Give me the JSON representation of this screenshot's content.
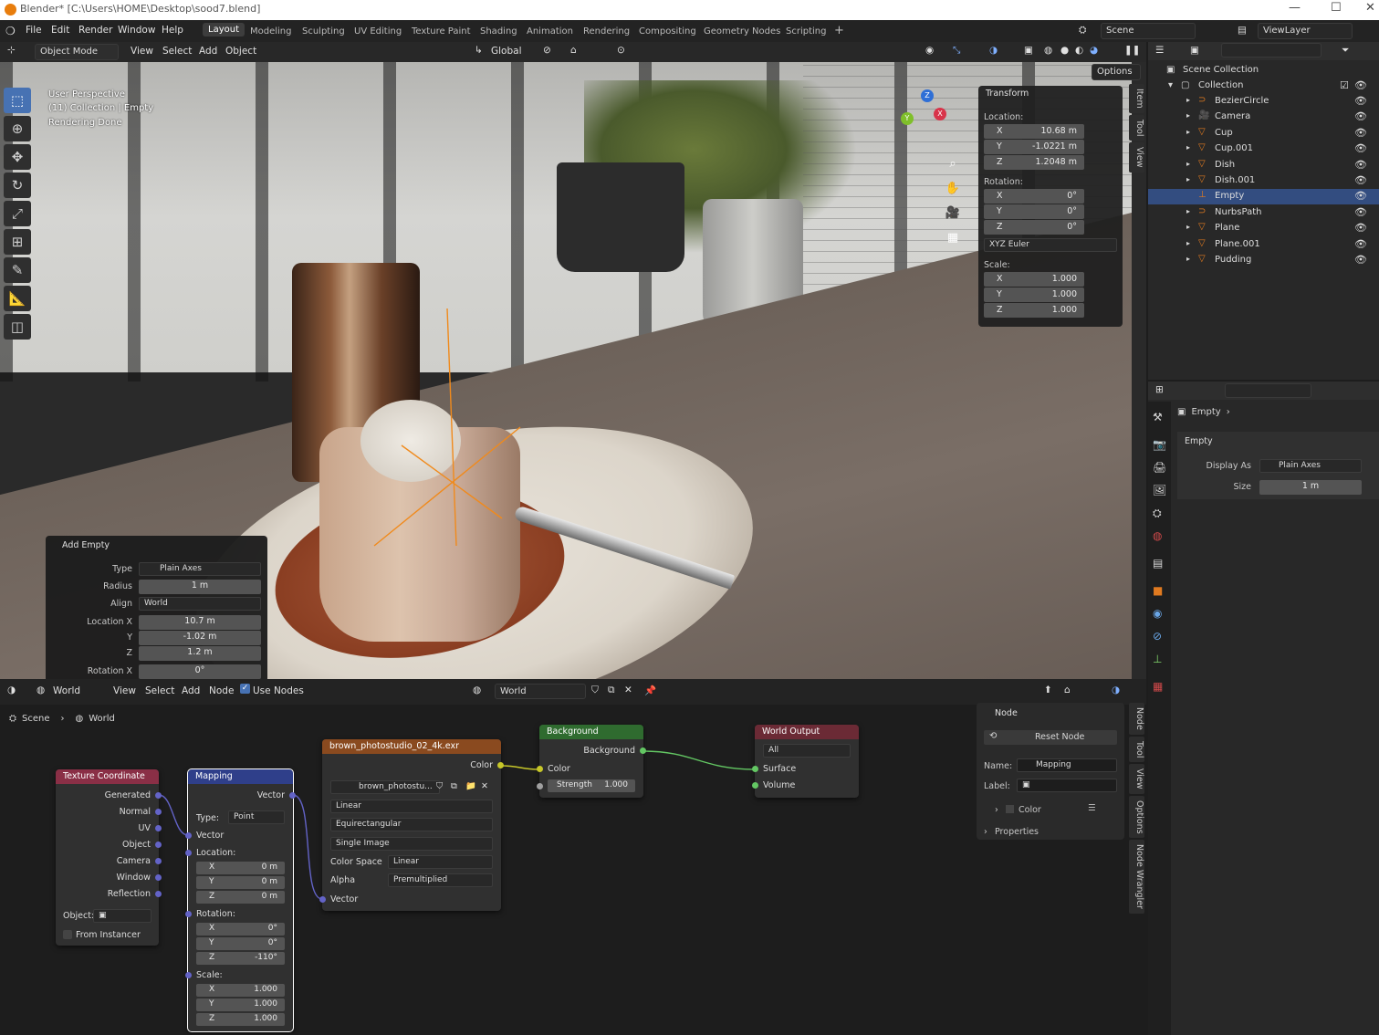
{
  "titlebar": {
    "title": "Blender* [C:\\Users\\HOME\\Desktop\\sood7.blend]"
  },
  "menu": [
    "File",
    "Edit",
    "Render",
    "Window",
    "Help"
  ],
  "workspaces": [
    "Layout",
    "Modeling",
    "Sculpting",
    "UV Editing",
    "Texture Paint",
    "Shading",
    "Animation",
    "Rendering",
    "Compositing",
    "Geometry Nodes",
    "Scripting"
  ],
  "active_workspace": "Layout",
  "scene": {
    "name": "Scene",
    "viewlayer": "ViewLayer"
  },
  "viewport": {
    "mode": "Object Mode",
    "menus": [
      "View",
      "Select",
      "Add",
      "Object"
    ],
    "orientation": "Global",
    "options": "Options",
    "overlay": [
      "User Perspective",
      "(11) Collection | Empty",
      "Rendering Done"
    ],
    "tabs": [
      "Item",
      "Tool",
      "View"
    ]
  },
  "transform": {
    "title": "Transform",
    "location_label": "Location:",
    "rotation_label": "Rotation:",
    "scale_label": "Scale:",
    "location": [
      {
        "k": "X",
        "v": "10.68 m"
      },
      {
        "k": "Y",
        "v": "-1.0221 m"
      },
      {
        "k": "Z",
        "v": "1.2048 m"
      }
    ],
    "rotation": [
      {
        "k": "X",
        "v": "0°"
      },
      {
        "k": "Y",
        "v": "0°"
      },
      {
        "k": "Z",
        "v": "0°"
      }
    ],
    "rotation_mode": "XYZ Euler",
    "scale": [
      {
        "k": "X",
        "v": "1.000"
      },
      {
        "k": "Y",
        "v": "1.000"
      },
      {
        "k": "Z",
        "v": "1.000"
      }
    ]
  },
  "add_empty": {
    "title": "Add Empty",
    "rows": [
      {
        "label": "Type",
        "value": "Plain Axes"
      },
      {
        "label": "Radius",
        "value": "1 m"
      },
      {
        "label": "Align",
        "value": "World"
      },
      {
        "label": "Location X",
        "value": "10.7 m"
      },
      {
        "label": "Y",
        "value": "-1.02 m"
      },
      {
        "label": "Z",
        "value": "1.2 m"
      },
      {
        "label": "Rotation X",
        "value": "0°"
      },
      {
        "label": "Y",
        "value": "0°"
      },
      {
        "label": "Z",
        "value": "0°"
      }
    ]
  },
  "outliner": {
    "root": "Scene Collection",
    "collection": "Collection",
    "items": [
      {
        "name": "BezierCircle",
        "selected": false
      },
      {
        "name": "Camera",
        "selected": false
      },
      {
        "name": "Cup",
        "selected": false
      },
      {
        "name": "Cup.001",
        "selected": false
      },
      {
        "name": "Dish",
        "selected": false
      },
      {
        "name": "Dish.001",
        "selected": false
      },
      {
        "name": "Empty",
        "selected": true
      },
      {
        "name": "NurbsPath",
        "selected": false
      },
      {
        "name": "Plane",
        "selected": false
      },
      {
        "name": "Plane.001",
        "selected": false
      },
      {
        "name": "Pudding",
        "selected": false
      }
    ]
  },
  "properties": {
    "breadcrumb": "Empty",
    "section": "Empty",
    "display_as_label": "Display As",
    "display_as": "Plain Axes",
    "size_label": "Size",
    "size": "1 m"
  },
  "node_editor": {
    "type": "World",
    "menus": [
      "View",
      "Select",
      "Add",
      "Node"
    ],
    "use_nodes": "Use Nodes",
    "world": "World",
    "breadcrumb": [
      "Scene",
      "World"
    ],
    "texcoord": {
      "title": "Texture Coordinate",
      "outputs": [
        "Generated",
        "Normal",
        "UV",
        "Object",
        "Camera",
        "Window",
        "Reflection"
      ],
      "object_label": "Object:",
      "from_instancer": "From Instancer"
    },
    "mapping": {
      "title": "Mapping",
      "out": "Vector",
      "type_label": "Type:",
      "type": "Point",
      "vector": "Vector",
      "location_label": "Location:",
      "location": [
        {
          "k": "X",
          "v": "0 m"
        },
        {
          "k": "Y",
          "v": "0 m"
        },
        {
          "k": "Z",
          "v": "0 m"
        }
      ],
      "rotation_label": "Rotation:",
      "rotation": [
        {
          "k": "X",
          "v": "0°"
        },
        {
          "k": "Y",
          "v": "0°"
        },
        {
          "k": "Z",
          "v": "-110°"
        }
      ],
      "scale_label": "Scale:",
      "scale": [
        {
          "k": "X",
          "v": "1.000"
        },
        {
          "k": "Y",
          "v": "1.000"
        },
        {
          "k": "Z",
          "v": "1.000"
        }
      ]
    },
    "envtex": {
      "title": "brown_photostudio_02_4k.exr",
      "out": "Color",
      "image": "brown_photostu...",
      "interp": "Linear",
      "proj": "Equirectangular",
      "source": "Single Image",
      "colorspace_label": "Color Space",
      "colorspace": "Linear",
      "alpha_label": "Alpha",
      "alpha": "Premultiplied",
      "vector": "Vector"
    },
    "background": {
      "title": "Background",
      "out": "Background",
      "color": "Color",
      "strength_label": "Strength",
      "strength": "1.000"
    },
    "output": {
      "title": "World Output",
      "target": "All",
      "surface": "Surface",
      "volume": "Volume"
    },
    "panel": {
      "title": "Node",
      "reset": "Reset Node",
      "name_label": "Name:",
      "name": "Mapping",
      "label_label": "Label:",
      "color": "Color",
      "properties": "Properties"
    },
    "tabs": [
      "Node",
      "Tool",
      "View",
      "Options",
      "Node Wrangler"
    ]
  }
}
